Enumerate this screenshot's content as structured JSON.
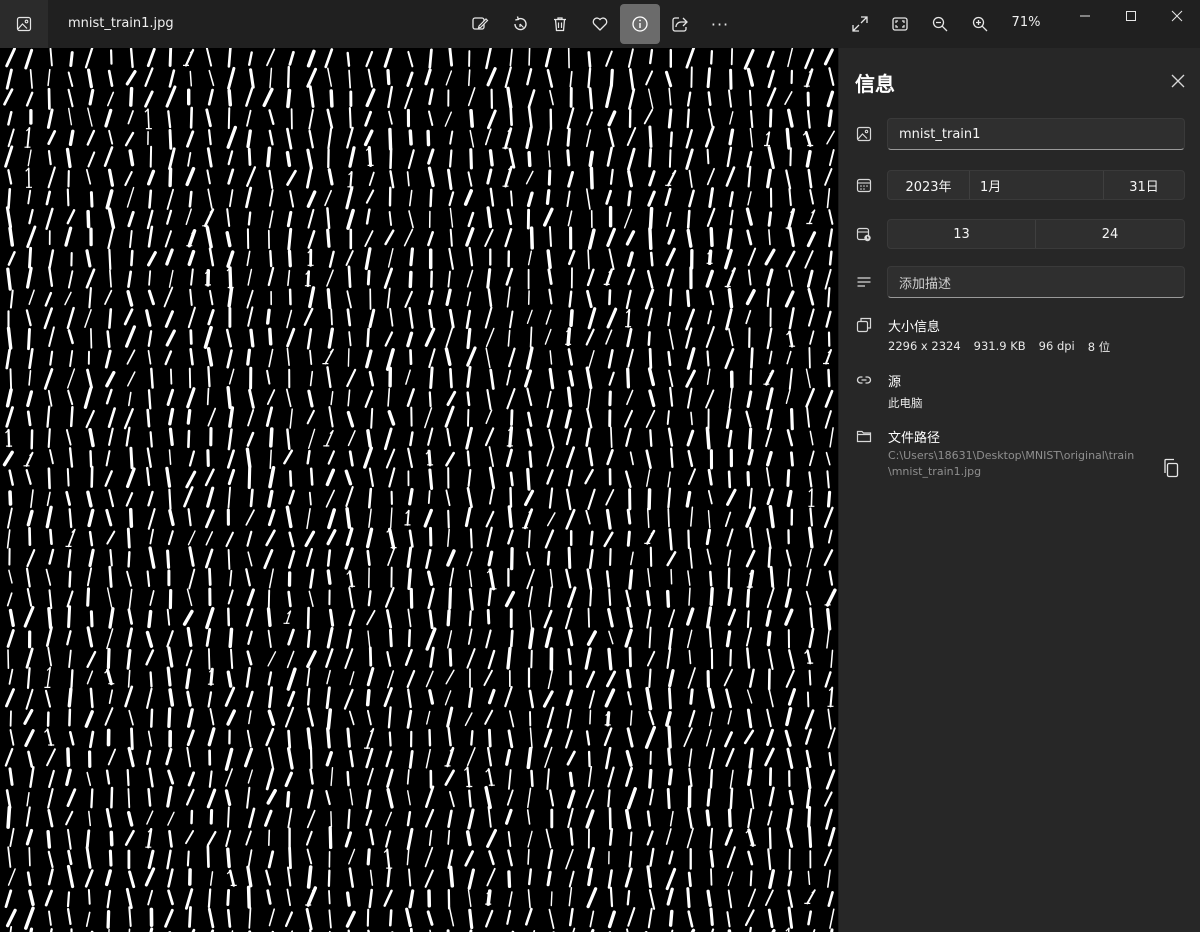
{
  "window": {
    "file_title": "mnist_train1.jpg",
    "zoom": "71%"
  },
  "toolbar": {
    "icons": [
      "photo-icon",
      "edit-icon",
      "rotate-icon",
      "delete-icon",
      "favorite-icon",
      "info-icon",
      "share-icon",
      "more-icon",
      "fullscreen-icon",
      "fit-icon",
      "zoom-out-icon",
      "zoom-in-icon"
    ],
    "more_label": "···"
  },
  "info": {
    "title": "信息",
    "name": "mnist_train1",
    "date": {
      "year": "2023年",
      "month": "1月",
      "day": "31日"
    },
    "time": {
      "hour": "13",
      "minute": "24"
    },
    "description_placeholder": "添加描述",
    "size": {
      "heading": "大小信息",
      "dimensions": "2296 x 2324",
      "filesize": "931.9 KB",
      "dpi": "96 dpi",
      "bitdepth": "8 位"
    },
    "source": {
      "heading": "源",
      "value": "此电脑"
    },
    "path": {
      "heading": "文件路径",
      "value": "C:\\Users\\18631\\Desktop\\MNIST\\original\\train\\mnist_train1.jpg"
    }
  },
  "colors": {
    "accent": "#6b6b6b",
    "panel": "#272727",
    "canvas": "#000000"
  }
}
